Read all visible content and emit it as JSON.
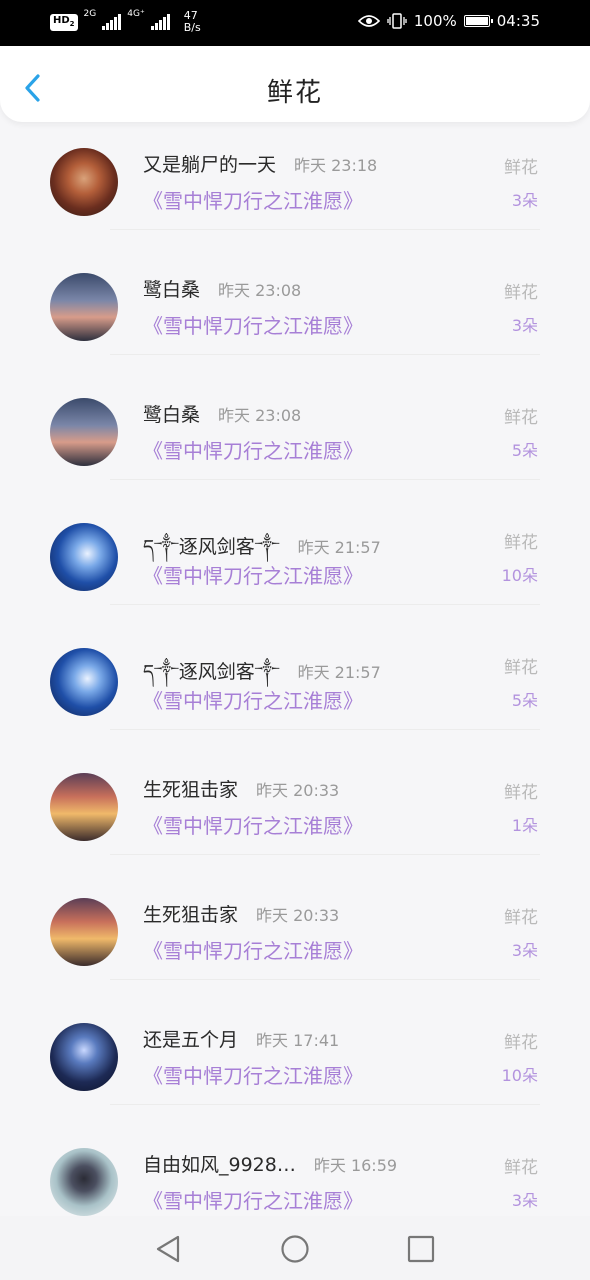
{
  "status_bar": {
    "hd": "HD",
    "hd_sub": "2",
    "net1": "2G",
    "net2": "4G⁺",
    "speed_value": "47",
    "speed_unit": "B/s",
    "battery": "100%",
    "battery_level": 1.0,
    "time": "04:35"
  },
  "header": {
    "title": "鲜花",
    "back_icon": "chevron-left-icon",
    "accent": "#2aa3e8"
  },
  "colors": {
    "book": "#a77fd6",
    "amount": "#b393de",
    "muted": "#9a9a9a"
  },
  "rows": [
    {
      "user": "又是躺尸的一天",
      "time": "昨天 23:18",
      "book": "《雪中悍刀行之江淮愿》",
      "kind": "鲜花",
      "amount": "3朵",
      "avatar": "ornate-portrait"
    },
    {
      "user": "鹭白桑",
      "time": "昨天 23:08",
      "book": "《雪中悍刀行之江淮愿》",
      "kind": "鲜花",
      "amount": "3朵",
      "avatar": "silhouette-sunset"
    },
    {
      "user": "鹭白桑",
      "time": "昨天 23:08",
      "book": "《雪中悍刀行之江淮愿》",
      "kind": "鲜花",
      "amount": "5朵",
      "avatar": "silhouette-sunset"
    },
    {
      "user": "ད༒逐风剑客༒",
      "time": "昨天 21:57",
      "book": "《雪中悍刀行之江淮愿》",
      "kind": "鲜花",
      "amount": "10朵",
      "avatar": "anime-blue"
    },
    {
      "user": "ད༒逐风剑客༒",
      "time": "昨天 21:57",
      "book": "《雪中悍刀行之江淮愿》",
      "kind": "鲜花",
      "amount": "5朵",
      "avatar": "anime-blue"
    },
    {
      "user": "生死狙击家",
      "time": "昨天 20:33",
      "book": "《雪中悍刀行之江淮愿》",
      "kind": "鲜花",
      "amount": "1朵",
      "avatar": "anime-sunset"
    },
    {
      "user": "生死狙击家",
      "time": "昨天 20:33",
      "book": "《雪中悍刀行之江淮愿》",
      "kind": "鲜花",
      "amount": "3朵",
      "avatar": "anime-sunset"
    },
    {
      "user": "还是五个月",
      "time": "昨天 17:41",
      "book": "《雪中悍刀行之江淮愿》",
      "kind": "鲜花",
      "amount": "10朵",
      "avatar": "anime-night"
    },
    {
      "user": "自由如风_9928…",
      "time": "昨天 16:59",
      "book": "《雪中悍刀行之江淮愿》",
      "kind": "鲜花",
      "amount": "3朵",
      "avatar": "anime-girl-flowers"
    }
  ],
  "nav": {
    "back": "triangle-back-icon",
    "home": "circle-home-icon",
    "recent": "square-recent-icon"
  }
}
